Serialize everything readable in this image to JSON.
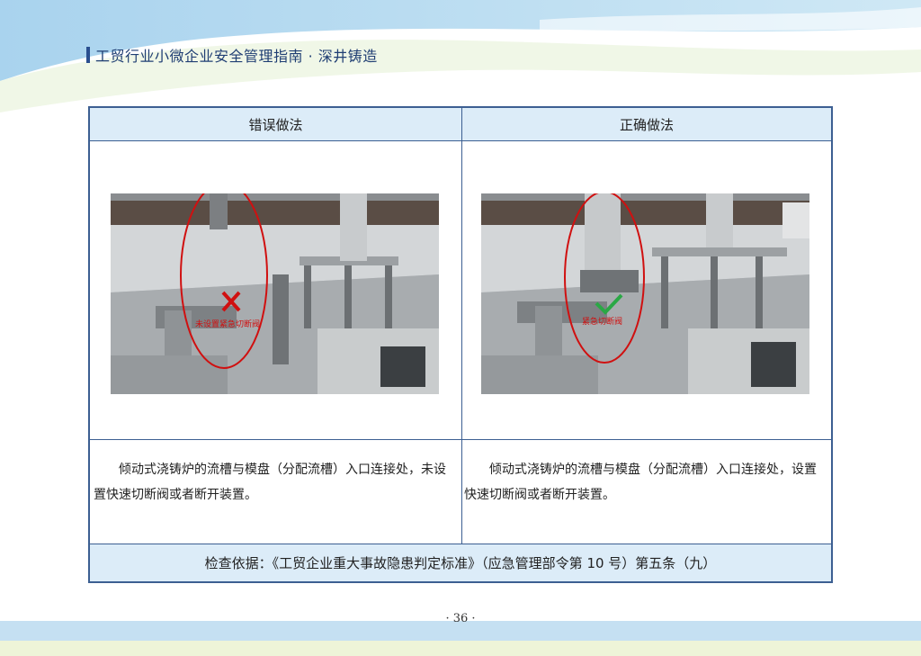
{
  "header": {
    "title": "工贸行业小微企业安全管理指南 · 深井铸造"
  },
  "table": {
    "wrong_title": "错误做法",
    "right_title": "正确做法",
    "wrong_desc": "倾动式浇铸炉的流槽与模盘（分配流槽）入口连接处，未设置快速切断阀或者断开装置。",
    "right_desc": "倾动式浇铸炉的流槽与模盘（分配流槽）入口连接处，设置快速切断阀或者断开装置。",
    "basis": "检查依据：《工贸企业重大事故隐患判定标准》（应急管理部令第 10 号）第五条（九）"
  },
  "photos": {
    "wrong_mark": "cross-icon",
    "right_mark": "check-icon",
    "wrong_label": "未设置紧急切断阀",
    "right_label": "紧急切断阀"
  },
  "colors": {
    "accent_blue": "#3c5f92",
    "header_fill": "#dcecf8",
    "wrong_red": "#d01010",
    "right_green": "#2aa845"
  },
  "footer": {
    "page": "· 36 ·"
  }
}
